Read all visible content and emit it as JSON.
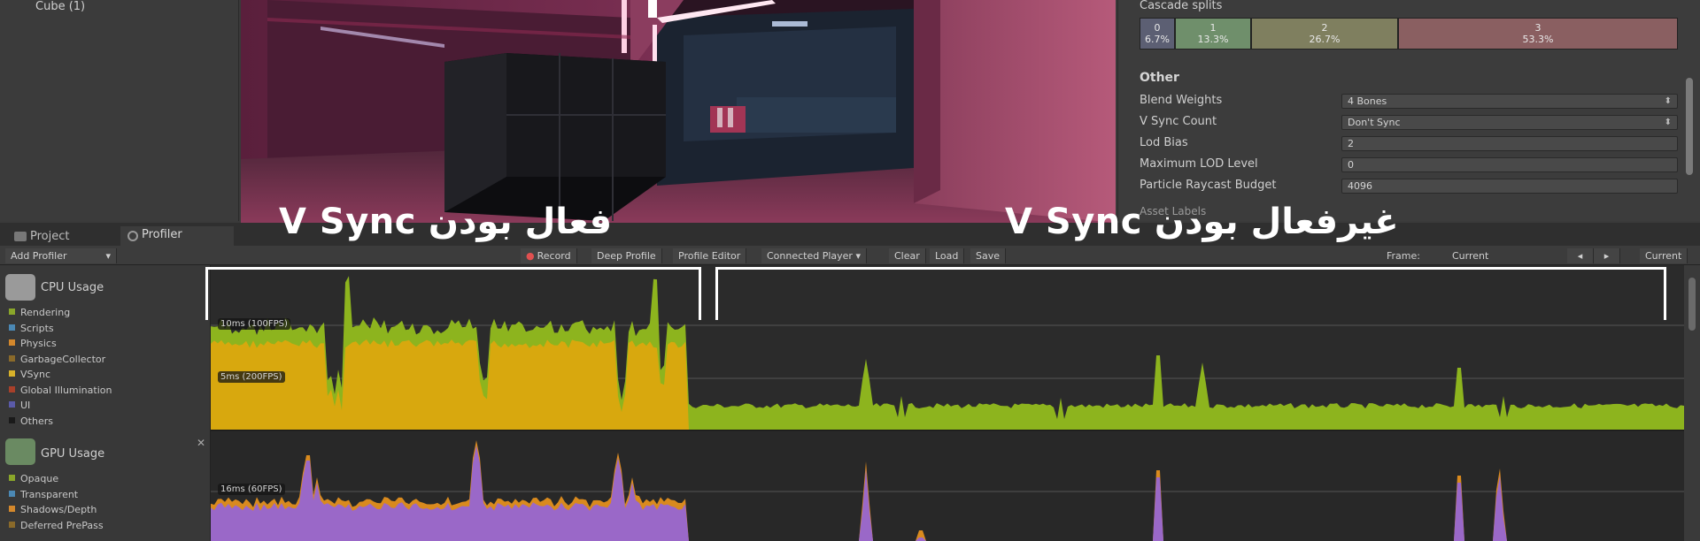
{
  "hierarchy": {
    "item": "Cube (1)"
  },
  "inspector": {
    "cascade_title": "Cascade splits",
    "cascade_splits": [
      {
        "index": "0",
        "pct": "6.7%",
        "color": "#5c5f73"
      },
      {
        "index": "1",
        "pct": "13.3%",
        "color": "#6f8f6b"
      },
      {
        "index": "2",
        "pct": "26.7%",
        "color": "#7f7f5f"
      },
      {
        "index": "3",
        "pct": "53.3%",
        "color": "#8a5f61"
      }
    ],
    "other_title": "Other",
    "rows": [
      {
        "label": "Blend Weights",
        "value": "4 Bones",
        "dropdown": true
      },
      {
        "label": "V Sync Count",
        "value": "Don't Sync",
        "dropdown": true
      },
      {
        "label": "Lod Bias",
        "value": "2",
        "dropdown": false
      },
      {
        "label": "Maximum LOD Level",
        "value": "0",
        "dropdown": false
      },
      {
        "label": "Particle Raycast Budget",
        "value": "4096",
        "dropdown": false
      }
    ],
    "cutoff_label": "Asset Labels"
  },
  "tabs": {
    "project": "Project",
    "profiler": "Profiler"
  },
  "toolbar": {
    "add_profiler": "Add Profiler",
    "record": "Record",
    "deep_profile": "Deep Profile",
    "profile_editor": "Profile Editor",
    "connected_player": "Connected Player",
    "clear": "Clear",
    "load": "Load",
    "save": "Save",
    "frame_label": "Frame:",
    "frame_value": "Current",
    "current_button": "Current"
  },
  "cpu": {
    "title": "CPU Usage",
    "legend": [
      {
        "label": "Rendering",
        "color": "#8aa62a"
      },
      {
        "label": "Scripts",
        "color": "#4b88b4"
      },
      {
        "label": "Physics",
        "color": "#d4882c"
      },
      {
        "label": "GarbageCollector",
        "color": "#8a6a2a"
      },
      {
        "label": "VSync",
        "color": "#d7b12a"
      },
      {
        "label": "Global Illumination",
        "color": "#a8402a"
      },
      {
        "label": "UI",
        "color": "#5a5aa8"
      },
      {
        "label": "Others",
        "color": "#1a1a1a"
      }
    ],
    "fps_labels": [
      "10ms (100FPS)",
      "5ms (200FPS)"
    ]
  },
  "gpu": {
    "title": "GPU Usage",
    "legend": [
      {
        "label": "Opaque",
        "color": "#8aa62a"
      },
      {
        "label": "Transparent",
        "color": "#4b88b4"
      },
      {
        "label": "Shadows/Depth",
        "color": "#d4882c"
      },
      {
        "label": "Deferred PrePass",
        "color": "#8a6a2a"
      }
    ],
    "fps_label": "16ms (60FPS)"
  },
  "annotations": {
    "vsync_on": "فعال بودن V Sync",
    "vsync_off": "غیرفعال بودن V Sync"
  }
}
